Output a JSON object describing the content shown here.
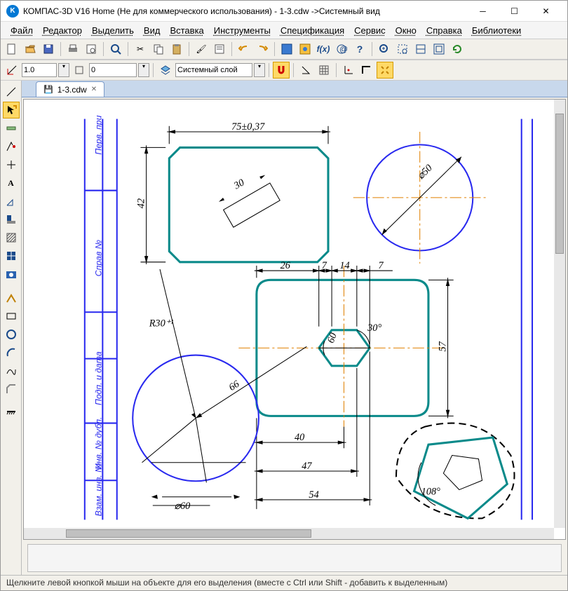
{
  "window": {
    "app_title": "КОМПАС-3D V16 Home  (Не для коммерческого использования) - 1-3.cdw ->Системный вид",
    "app_icon_letter": "K"
  },
  "menu": {
    "file": "Файл",
    "editor": "Редактор",
    "select": "Выделить",
    "view": "Вид",
    "insert": "Вставка",
    "tools": "Инструменты",
    "spec": "Спецификация",
    "service": "Сервис",
    "window": "Окно",
    "help": "Справка",
    "libraries": "Библиотеки"
  },
  "toolbar2": {
    "line_weight": "1.0",
    "step": "0",
    "layer": "Системный слой"
  },
  "tab": {
    "label": "1-3.cdw"
  },
  "drawing": {
    "dimensions": {
      "top_width": "75±0,37",
      "top_height": "42",
      "top_inner": "30",
      "circle_right": "⌀50",
      "mid_26": "26",
      "mid_7a": "7",
      "mid_14": "14",
      "mid_7b": "7",
      "mid_height": "57",
      "mid_40": "40",
      "mid_47": "47",
      "mid_54": "54",
      "hex_60": "60",
      "hex_30": "30°",
      "radius": "R30⁺¹",
      "leader_66": "66",
      "circle_left": "⌀60",
      "angle_108": "108°"
    },
    "stamp_labels": {
      "perv": "Перв. при",
      "sprav": "Справ №",
      "podp": "Подп. и дата",
      "inv_dubl": "Инв. № дубл.",
      "vzam": "Взам. инв. №"
    }
  },
  "status": {
    "text": "Щелкните левой кнопкой мыши на объекте для его выделения (вместе с Ctrl или Shift - добавить к выделенным)"
  }
}
